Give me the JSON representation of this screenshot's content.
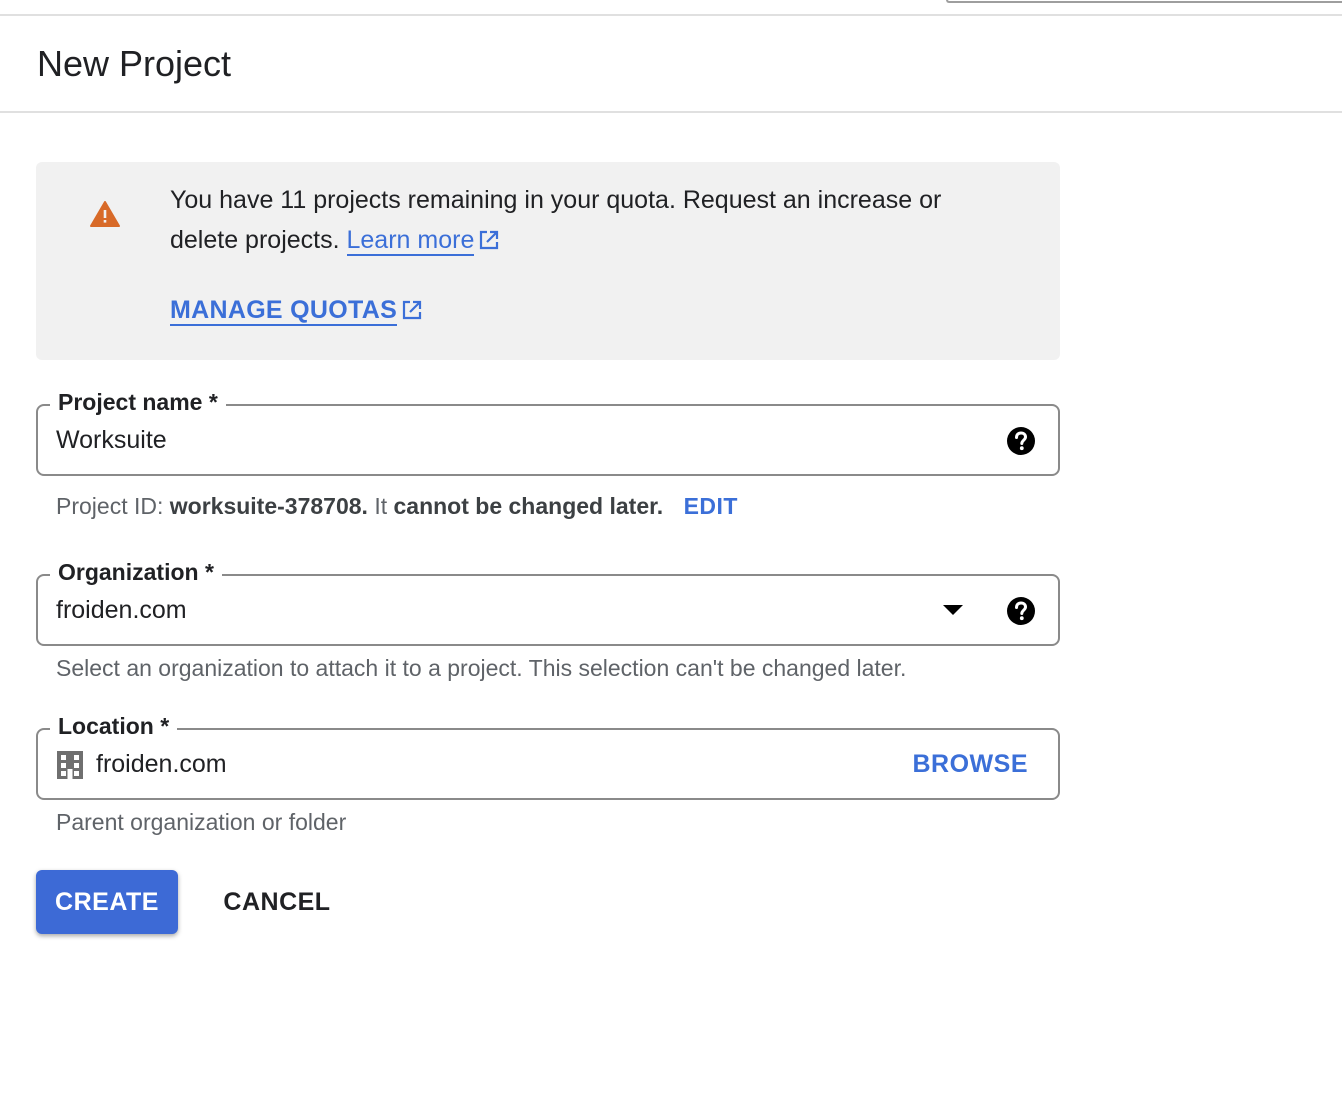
{
  "header": {
    "title": "New Project"
  },
  "quota_notice": {
    "icon": "warning-icon",
    "message": "You have 11 projects remaining in your quota. Request an increase or delete projects.",
    "learn_more_label": "Learn more",
    "manage_quotas_label": "MANAGE QUOTAS",
    "colors": {
      "warning": "#d86a28",
      "link": "#3b6fd8",
      "background": "#f1f1f1"
    }
  },
  "project_name": {
    "label": "Project name *",
    "value": "Worksuite",
    "help_icon": "help-icon",
    "project_id_prefix": "Project ID:",
    "project_id": "worksuite-378708.",
    "project_id_note_lead": "It",
    "project_id_note_bold": "cannot be changed later.",
    "edit_label": "EDIT"
  },
  "organization": {
    "label": "Organization *",
    "value": "froiden.com",
    "help_icon": "help-icon",
    "dropdown_icon": "caret-down-icon",
    "helper": "Select an organization to attach it to a project. This selection can't be changed later."
  },
  "location": {
    "label": "Location *",
    "value": "froiden.com",
    "icon": "building-icon",
    "browse_label": "BROWSE",
    "helper": "Parent organization or folder"
  },
  "actions": {
    "create_label": "CREATE",
    "cancel_label": "CANCEL",
    "primary_color": "#3d6ad6"
  }
}
